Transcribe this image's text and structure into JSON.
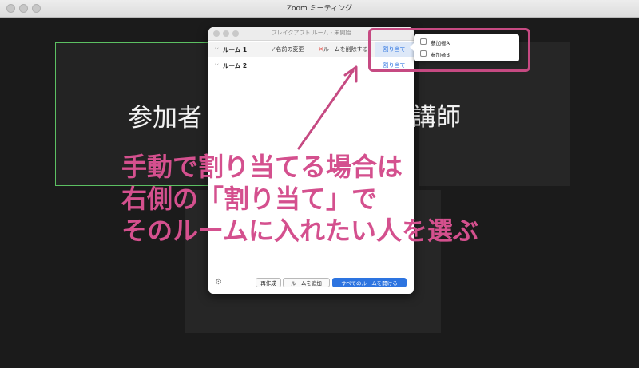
{
  "window": {
    "title": "Zoom ミーティング"
  },
  "participants": {
    "tile_a_name": "参加者",
    "tile_b_name": "講師"
  },
  "breakout": {
    "title": "ブレイクアウト ルーム - 未開始",
    "rooms": [
      {
        "label": "ルーム 1",
        "rename": "名前の変更",
        "delete": "ルームを削除する",
        "assign": "割り当て"
      },
      {
        "label": "ルーム 2",
        "assign": "割り当て"
      }
    ],
    "footer": {
      "recreate": "再作成",
      "add_room": "ルームを追加",
      "open_all": "すべてのルームを開ける"
    }
  },
  "assign_popup": {
    "items": [
      {
        "label": "参加者A",
        "checked": false
      },
      {
        "label": "参加者B",
        "checked": false
      }
    ]
  },
  "annotation": {
    "lines": [
      "手動で割り当てる場合は",
      "右側の「割り当て」で",
      "そのルームに入れたい人を選ぶ"
    ],
    "color": "#d4508e"
  },
  "colors": {
    "accent": "#2d74e0",
    "highlight": "#c64a82",
    "active_speaker": "#5cc062"
  }
}
